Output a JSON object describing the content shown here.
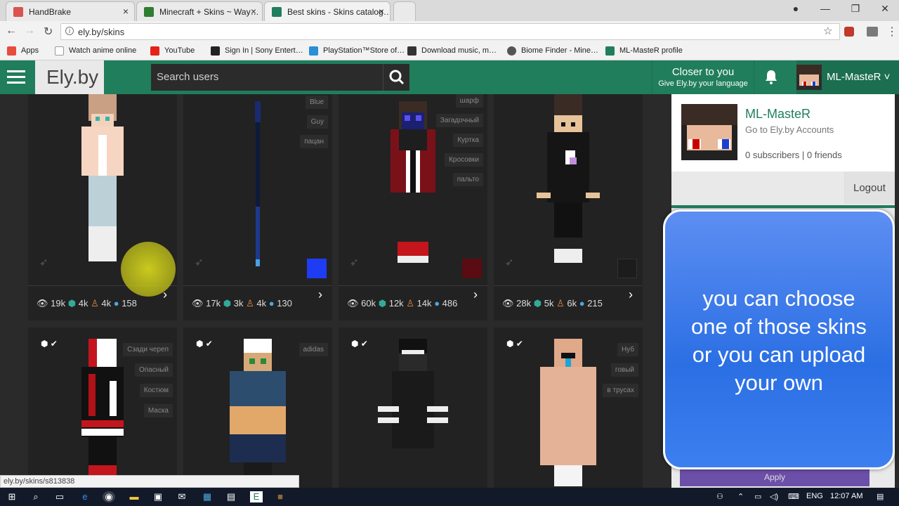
{
  "browser": {
    "tabs": [
      {
        "title": "HandBrake",
        "color": "#d9534f"
      },
      {
        "title": "Minecraft + Skins ~ Way…",
        "color": "#2e7d32"
      },
      {
        "title": "Best skins - Skins catalog…",
        "color": "#207e5c"
      }
    ],
    "url": "ely.by/skins",
    "bookmarks": [
      {
        "label": "Apps",
        "color": "#e74c3c"
      },
      {
        "label": "Watch anime online",
        "color": "#999"
      },
      {
        "label": "YouTube",
        "color": "#e62117"
      },
      {
        "label": "Sign In | Sony Entert…",
        "color": "#222"
      },
      {
        "label": "PlayStation™Store of…",
        "color": "#2a8fd6"
      },
      {
        "label": "Download music, m…",
        "color": "#333"
      },
      {
        "label": "Biome Finder - Mine…",
        "color": "#555"
      },
      {
        "label": "ML-MasteR profile",
        "color": "#207e5c"
      }
    ]
  },
  "header": {
    "logo": "Ely.by",
    "search_placeholder": "Search users",
    "closer_title": "Closer to you",
    "closer_sub": "Give Ely.by your language",
    "username": "ML-MasteR"
  },
  "cards": [
    {
      "stats": {
        "views": "19k",
        "likes": "4k",
        "users": "4k",
        "comments": "158"
      },
      "tags": [],
      "swatch": ""
    },
    {
      "stats": {
        "views": "17k",
        "likes": "3k",
        "users": "4k",
        "comments": "130"
      },
      "tags": [
        "Blue",
        "Guy",
        "пацан"
      ],
      "swatch": "#1f3cf5"
    },
    {
      "stats": {
        "views": "60k",
        "likes": "12k",
        "users": "14k",
        "comments": "486"
      },
      "tags": [
        "шарф",
        "Загадочный",
        "Куртка",
        "Кросовки",
        "пальто"
      ],
      "swatch": "#5a0c12"
    },
    {
      "stats": {
        "views": "28k",
        "likes": "5k",
        "users": "6k",
        "comments": "215"
      },
      "tags": [],
      "swatch": "#1c1c1c"
    },
    {
      "tags": [
        "Сзади череп",
        "Опасный",
        "Костюм",
        "Маска"
      ]
    },
    {
      "tags": [
        "adidas"
      ]
    },
    {
      "tags": []
    },
    {
      "tags": [
        "Нуб",
        "говый",
        "в трусах"
      ]
    }
  ],
  "profile": {
    "name": "ML-MasteR",
    "link": "Go to Ely.by Accounts",
    "stats": "0 subscribers | 0 friends",
    "logout": "Logout",
    "apply": "Apply"
  },
  "overlay": {
    "line1": "you can choose",
    "line2": "one of those skins",
    "line3": "or you can upload",
    "line4": "your own"
  },
  "status_url": "ely.by/skins/s813838",
  "taskbar": {
    "lang": "ENG",
    "time": "12:07 AM"
  }
}
